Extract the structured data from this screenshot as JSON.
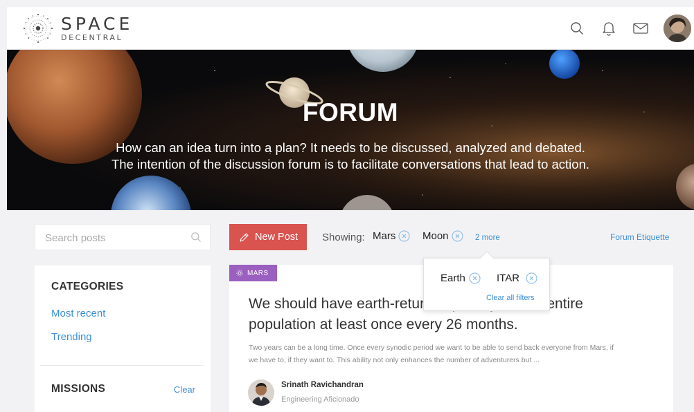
{
  "header": {
    "logo_title": "SPACE",
    "logo_subtitle": "DECENTRAL",
    "icons": [
      "search-icon",
      "bell-icon",
      "mail-icon"
    ]
  },
  "hero": {
    "title": "FORUM",
    "line1": "How can an idea turn into a plan? It needs to be discussed, analyzed and debated.",
    "line2": "The intention of the discussion forum is to facilitate conversations that lead to action."
  },
  "sidebar": {
    "search_placeholder": "Search posts",
    "categories_heading": "CATEGORIES",
    "categories": [
      "Most recent",
      "Trending"
    ],
    "missions_heading": "MISSIONS",
    "missions_clear": "Clear"
  },
  "toolbar": {
    "new_post_label": "New Post",
    "showing_label": "Showing:",
    "filters": [
      "Mars",
      "Moon"
    ],
    "more_label": "2 more",
    "etiquette_label": "Forum Etiquette"
  },
  "popover": {
    "filters": [
      "Earth",
      "ITAR"
    ],
    "clear_all_label": "Clear all filters"
  },
  "post": {
    "tag": "MARS",
    "title_line1": "We should have earth-return capability for the entire",
    "title_line2": "population at least once every 26 months.",
    "excerpt_line1": "Two years can be a long time. Once every synodic period we want to be able to send back everyone from Mars, if",
    "excerpt_line2": "we have to, if they want to. This ability not only enhances the number of adventurers but ...",
    "author_name": "Srinath Ravichandran",
    "author_role": "Engineering Aficionado"
  },
  "colors": {
    "accent_link": "#3d8fd4",
    "new_post_button": "#d9534f",
    "tag_purple": "#9b5fc0"
  }
}
